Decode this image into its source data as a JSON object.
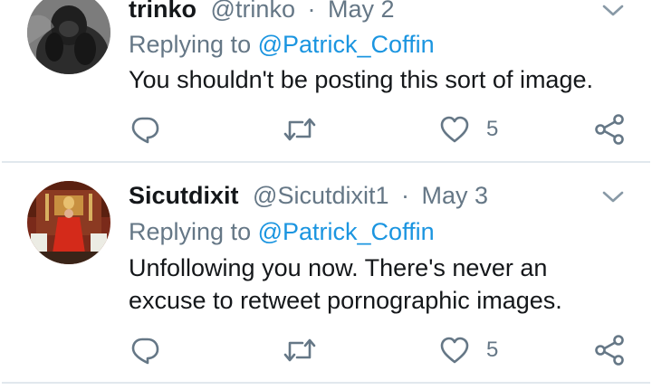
{
  "tweets": [
    {
      "name": "trinko",
      "handle": "@trinko",
      "separator": "·",
      "date": "May 2",
      "replying_prefix": "Replying to",
      "replying_to": "@Patrick_Coffin",
      "text": "You shouldn't be posting this sort of image.",
      "like_count": "5",
      "avatar": "gorilla-photo"
    },
    {
      "name": "Sicutdixit",
      "handle": "@Sicutdixit1",
      "separator": "·",
      "date": "May 3",
      "replying_prefix": "Replying to",
      "replying_to": "@Patrick_Coffin",
      "text": "Unfollowing you now. There's never an excuse to retweet pornographic images.",
      "like_count": "5",
      "avatar": "church-altar-photo"
    }
  ],
  "icons": {
    "reply": "reply-icon",
    "retweet": "retweet-icon",
    "like": "heart-icon",
    "share": "share-icon",
    "menu": "chevron-down-icon"
  },
  "colors": {
    "mention": "#1b95e0",
    "secondary_text": "#657786",
    "primary_text": "#14171a",
    "divider": "#e1e8ed"
  }
}
